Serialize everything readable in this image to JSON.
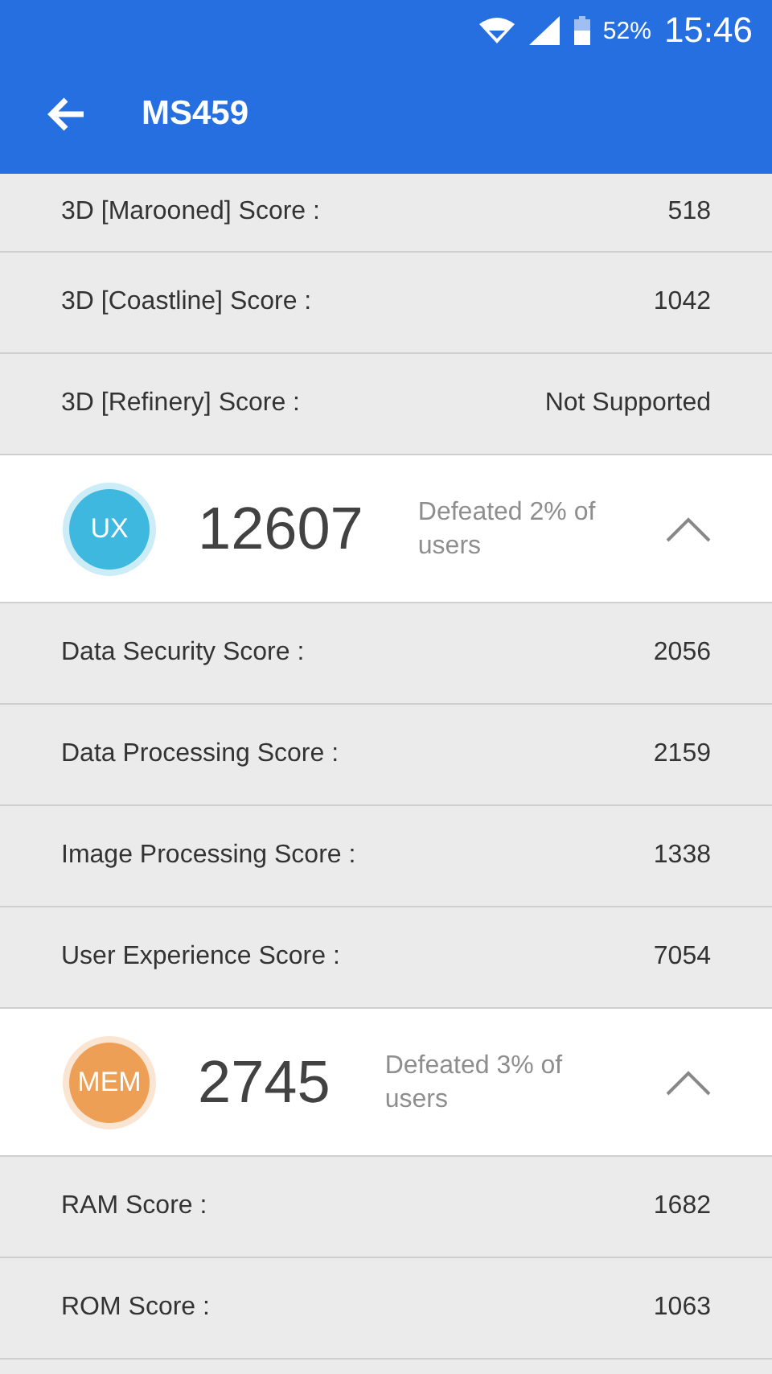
{
  "status_bar": {
    "battery": "52%",
    "time": "15:46"
  },
  "app_bar": {
    "title": "MS459"
  },
  "sections": [
    {
      "rows": [
        {
          "label": "3D [Marooned] Score :",
          "value": "518"
        },
        {
          "label": "3D [Coastline] Score :",
          "value": "1042"
        },
        {
          "label": "3D [Refinery] Score :",
          "value": "Not Supported"
        }
      ]
    },
    {
      "header": {
        "badge": "UX",
        "color": "#3fb8e0",
        "score": "12607",
        "defeated": "Defeated 2% of users",
        "expanded": true
      },
      "rows": [
        {
          "label": "Data Security Score :",
          "value": "2056"
        },
        {
          "label": "Data Processing Score :",
          "value": "2159"
        },
        {
          "label": "Image Processing Score :",
          "value": "1338"
        },
        {
          "label": "User Experience Score :",
          "value": "7054"
        }
      ]
    },
    {
      "header": {
        "badge": "MEM",
        "color": "#ec9f55",
        "score": "2745",
        "defeated": "Defeated 3% of users",
        "expanded": true
      },
      "rows": [
        {
          "label": "RAM Score :",
          "value": "1682"
        },
        {
          "label": "ROM Score :",
          "value": "1063"
        }
      ]
    }
  ]
}
